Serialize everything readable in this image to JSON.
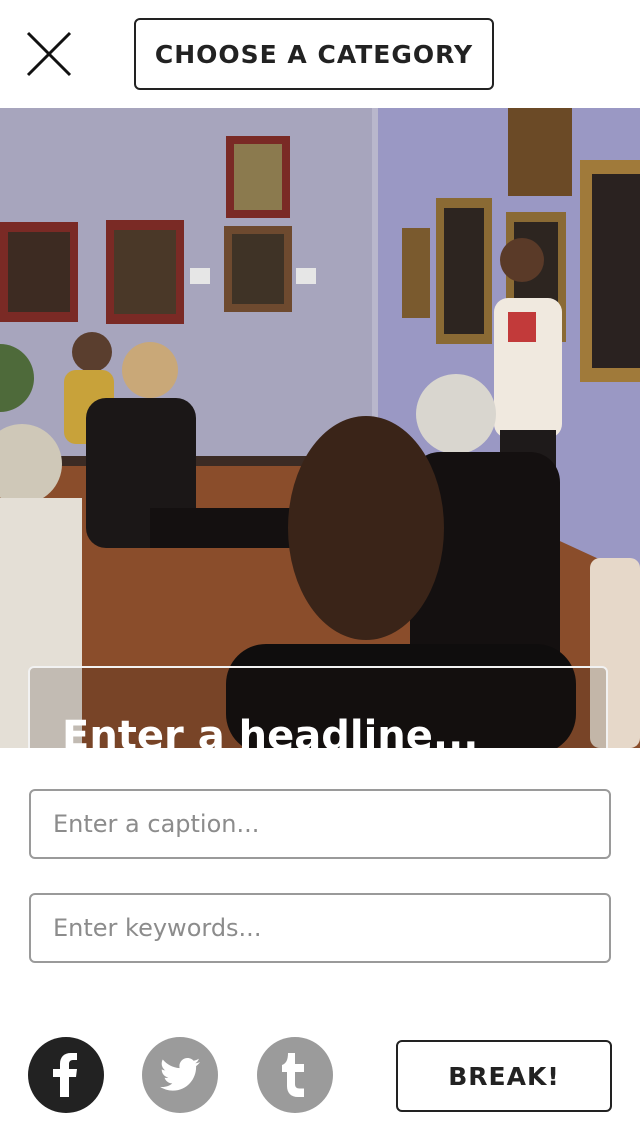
{
  "header": {
    "close_icon": "close-icon",
    "category_button_label": "CHOOSE A CATEGORY"
  },
  "photo": {
    "headline_placeholder": "Enter a headline..."
  },
  "form": {
    "caption_placeholder": "Enter a caption...",
    "keywords_placeholder": "Enter keywords..."
  },
  "share": {
    "facebook_icon": "facebook-icon",
    "twitter_icon": "twitter-icon",
    "tumblr_icon": "tumblr-icon",
    "facebook_color": "#222222",
    "inactive_color": "#9b9b9b"
  },
  "actions": {
    "break_label": "BREAK!"
  }
}
